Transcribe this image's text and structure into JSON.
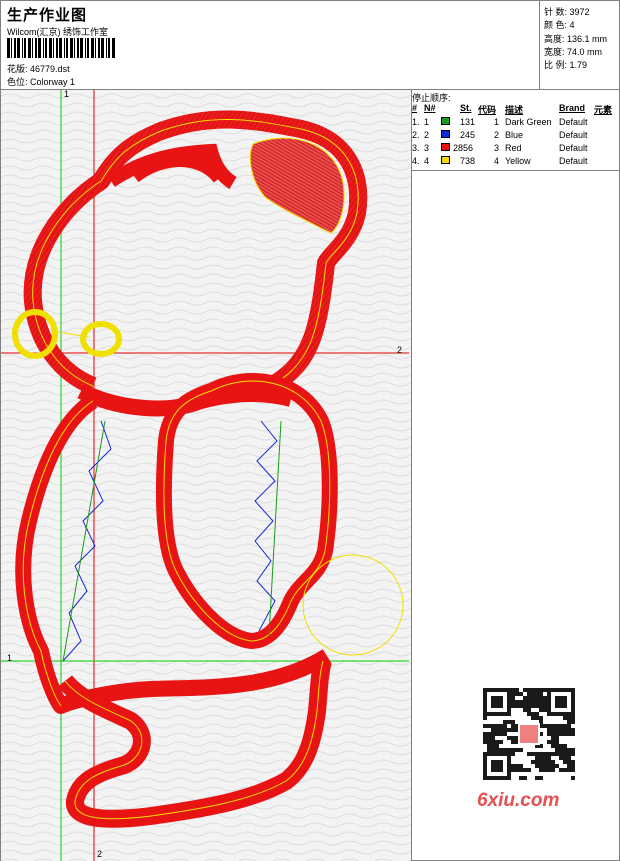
{
  "header": {
    "title": "生产作业图",
    "company": "Wilcom(汇京) 绣饰工作室",
    "design_label": "花版:",
    "design_value": "46779.dst",
    "colorway_label": "色位:",
    "colorway_value": "Colorway 1"
  },
  "stats": {
    "stitches": "针 数: 3972",
    "colors": "颜 色: 4",
    "height": "高度: 136.1 mm",
    "width": "宽度: 74.0 mm",
    "scale": "比 例: 1.79"
  },
  "stop_sequence": {
    "title": "停止顺序:",
    "headers": {
      "num": "#",
      "needle": "N#",
      "stitches": "St.",
      "code": "代码",
      "desc": "描述",
      "brand": "Brand",
      "element": "元素"
    },
    "rows": [
      {
        "num": "1.",
        "needle": "1",
        "stitches": "131",
        "code": "1",
        "desc": "Dark Green",
        "brand": "Default",
        "color": "#1a9a1a"
      },
      {
        "num": "2.",
        "needle": "2",
        "stitches": "245",
        "code": "2",
        "desc": "Blue",
        "brand": "Default",
        "color": "#1428d8"
      },
      {
        "num": "3.",
        "needle": "3",
        "stitches": "2856",
        "code": "3",
        "desc": "Red",
        "brand": "Default",
        "color": "#e81414"
      },
      {
        "num": "4.",
        "needle": "4",
        "stitches": "738",
        "code": "4",
        "desc": "Yellow",
        "brand": "Default",
        "color": "#f0e000"
      }
    ]
  },
  "guides": {
    "v1": "1",
    "h1": "1",
    "v2": "2",
    "h2": "2"
  },
  "watermark": {
    "text": "6xiu.com"
  },
  "colors": {
    "green": "#00cc00",
    "red": "#e00000",
    "yellow": "#f0e000",
    "blue": "#1428d8"
  }
}
